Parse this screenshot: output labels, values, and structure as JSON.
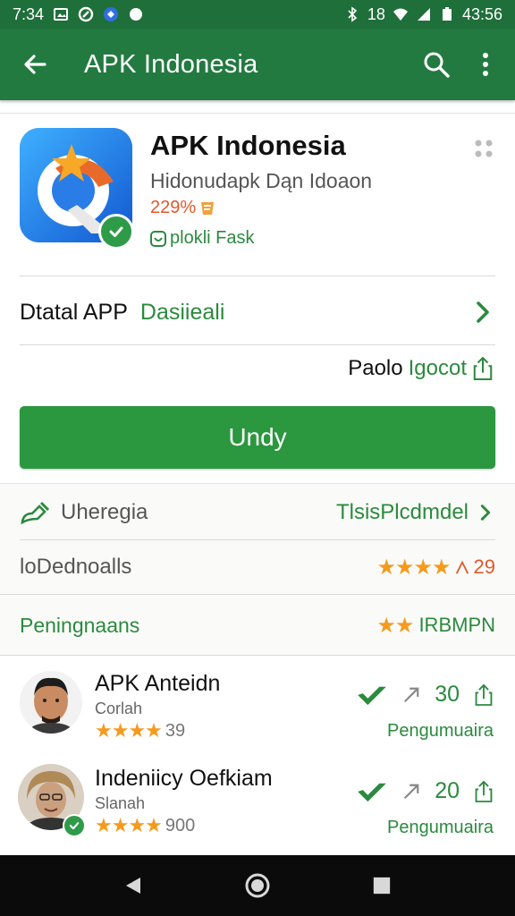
{
  "status_bar": {
    "time": "7:34",
    "clock_right": "43:56",
    "network": "18"
  },
  "app_bar": {
    "title": "APK Indonesia"
  },
  "app": {
    "name": "APK Indonesia",
    "subtitle": "Hidonudapk Dąn Idoaon",
    "rating_text": "229%",
    "feature_text": "plokli Fask",
    "icon_color": "#1e7ae6"
  },
  "detail": {
    "label": "Dtatal APP",
    "value": "Dasiieali"
  },
  "share": {
    "label1": "Paolo",
    "label2": "Igocot"
  },
  "install_button": {
    "label": "Undy"
  },
  "info": {
    "row1_label": "Uheregia",
    "row1_value": "TlsisPlcdmdel",
    "row2_label": "loDednoalls",
    "row2_value": "29",
    "row2_stars": "★★★★",
    "section_title": "Peningnaans",
    "section_stars": "★★",
    "section_right": "IRBMPN"
  },
  "reviews": [
    {
      "name": "APK Anteidn",
      "sub": "Corlah",
      "stars": "★★★★",
      "rating_count": "39",
      "count": "30",
      "footer": "Pengumuaira"
    },
    {
      "name": "Indeniicy Oefkiam",
      "sub": "Slanah",
      "stars": "★★★★",
      "rating_count": "900",
      "count": "20",
      "footer": "Pengumuaira"
    }
  ],
  "colors": {
    "primary_green": "#237a40",
    "accent_green": "#2b973f",
    "text_green": "#2b8a3e",
    "star_orange": "#f59a1d",
    "rating_orange": "#e0592a"
  }
}
